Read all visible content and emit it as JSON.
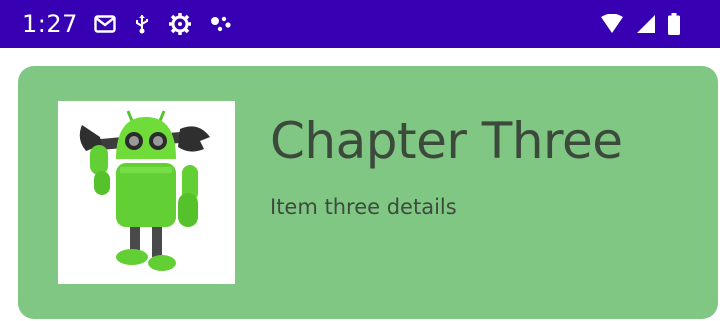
{
  "status_bar": {
    "time": "1:27",
    "icons": [
      "gmail-icon",
      "usb-icon",
      "settings-gear-icon",
      "assistant-dots-icon",
      "wifi-icon",
      "signal-icon",
      "battery-icon"
    ],
    "background": "#3700b3"
  },
  "card": {
    "title": "Chapter Three",
    "details": "Item three details",
    "image": "android-robot-with-wrench-icon",
    "background": "#81c784"
  }
}
